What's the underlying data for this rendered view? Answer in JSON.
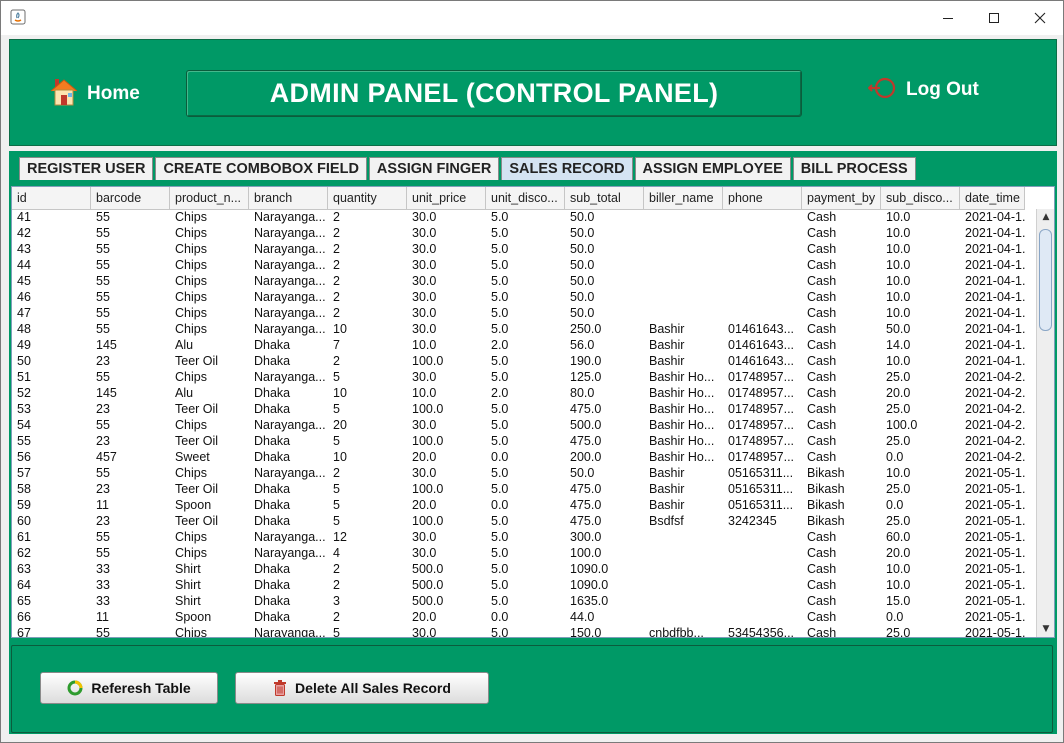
{
  "window": {
    "minimize": "—",
    "maximize": "☐",
    "close": "✕"
  },
  "header": {
    "home_label": "Home",
    "title": "ADMIN PANEL (CONTROL PANEL)",
    "logout_label": "Log Out"
  },
  "tabs": [
    {
      "label": "REGISTER USER",
      "active": false
    },
    {
      "label": "CREATE COMBOBOX FIELD",
      "active": false
    },
    {
      "label": "ASSIGN FINGER",
      "active": false
    },
    {
      "label": "SALES RECORD",
      "active": true
    },
    {
      "label": "ASSIGN EMPLOYEE",
      "active": false
    },
    {
      "label": "BILL PROCESS",
      "active": false
    }
  ],
  "table": {
    "columns": [
      "id",
      "barcode",
      "product_n...",
      "branch",
      "quantity",
      "unit_price",
      "unit_disco...",
      "sub_total",
      "biller_name",
      "phone",
      "payment_by",
      "sub_disco...",
      "date_time"
    ],
    "rows": [
      [
        "41",
        "55",
        "Chips",
        "Narayanga...",
        "2",
        "30.0",
        "5.0",
        "50.0",
        "",
        "",
        "Cash",
        "10.0",
        "2021-04-1..."
      ],
      [
        "42",
        "55",
        "Chips",
        "Narayanga...",
        "2",
        "30.0",
        "5.0",
        "50.0",
        "",
        "",
        "Cash",
        "10.0",
        "2021-04-1..."
      ],
      [
        "43",
        "55",
        "Chips",
        "Narayanga...",
        "2",
        "30.0",
        "5.0",
        "50.0",
        "",
        "",
        "Cash",
        "10.0",
        "2021-04-1..."
      ],
      [
        "44",
        "55",
        "Chips",
        "Narayanga...",
        "2",
        "30.0",
        "5.0",
        "50.0",
        "",
        "",
        "Cash",
        "10.0",
        "2021-04-1..."
      ],
      [
        "45",
        "55",
        "Chips",
        "Narayanga...",
        "2",
        "30.0",
        "5.0",
        "50.0",
        "",
        "",
        "Cash",
        "10.0",
        "2021-04-1..."
      ],
      [
        "46",
        "55",
        "Chips",
        "Narayanga...",
        "2",
        "30.0",
        "5.0",
        "50.0",
        "",
        "",
        "Cash",
        "10.0",
        "2021-04-1..."
      ],
      [
        "47",
        "55",
        "Chips",
        "Narayanga...",
        "2",
        "30.0",
        "5.0",
        "50.0",
        "",
        "",
        "Cash",
        "10.0",
        "2021-04-1..."
      ],
      [
        "48",
        "55",
        "Chips",
        "Narayanga...",
        "10",
        "30.0",
        "5.0",
        "250.0",
        "Bashir",
        "01461643...",
        "Cash",
        "50.0",
        "2021-04-1..."
      ],
      [
        "49",
        "145",
        "Alu",
        "Dhaka",
        "7",
        "10.0",
        "2.0",
        "56.0",
        "Bashir",
        "01461643...",
        "Cash",
        "14.0",
        "2021-04-1..."
      ],
      [
        "50",
        "23",
        "Teer Oil",
        "Dhaka",
        "2",
        "100.0",
        "5.0",
        "190.0",
        "Bashir",
        "01461643...",
        "Cash",
        "10.0",
        "2021-04-1..."
      ],
      [
        "51",
        "55",
        "Chips",
        "Narayanga...",
        "5",
        "30.0",
        "5.0",
        "125.0",
        "Bashir Ho...",
        "01748957...",
        "Cash",
        "25.0",
        "2021-04-2..."
      ],
      [
        "52",
        "145",
        "Alu",
        "Dhaka",
        "10",
        "10.0",
        "2.0",
        "80.0",
        "Bashir Ho...",
        "01748957...",
        "Cash",
        "20.0",
        "2021-04-2..."
      ],
      [
        "53",
        "23",
        "Teer Oil",
        "Dhaka",
        "5",
        "100.0",
        "5.0",
        "475.0",
        "Bashir Ho...",
        "01748957...",
        "Cash",
        "25.0",
        "2021-04-2..."
      ],
      [
        "54",
        "55",
        "Chips",
        "Narayanga...",
        "20",
        "30.0",
        "5.0",
        "500.0",
        "Bashir Ho...",
        "01748957...",
        "Cash",
        "100.0",
        "2021-04-2..."
      ],
      [
        "55",
        "23",
        "Teer Oil",
        "Dhaka",
        "5",
        "100.0",
        "5.0",
        "475.0",
        "Bashir Ho...",
        "01748957...",
        "Cash",
        "25.0",
        "2021-04-2..."
      ],
      [
        "56",
        "457",
        "Sweet",
        "Dhaka",
        "10",
        "20.0",
        "0.0",
        "200.0",
        "Bashir Ho...",
        "01748957...",
        "Cash",
        "0.0",
        "2021-04-2..."
      ],
      [
        "57",
        "55",
        "Chips",
        "Narayanga...",
        "2",
        "30.0",
        "5.0",
        "50.0",
        "Bashir",
        "05165311...",
        "Bikash",
        "10.0",
        "2021-05-1..."
      ],
      [
        "58",
        "23",
        "Teer Oil",
        "Dhaka",
        "5",
        "100.0",
        "5.0",
        "475.0",
        "Bashir",
        "05165311...",
        "Bikash",
        "25.0",
        "2021-05-1..."
      ],
      [
        "59",
        "11",
        "Spoon",
        "Dhaka",
        "5",
        "20.0",
        "0.0",
        "475.0",
        "Bashir",
        "05165311...",
        "Bikash",
        "0.0",
        "2021-05-1..."
      ],
      [
        "60",
        "23",
        "Teer Oil",
        "Dhaka",
        "5",
        "100.0",
        "5.0",
        "475.0",
        "Bsdfsf",
        "3242345",
        "Bikash",
        "25.0",
        "2021-05-1..."
      ],
      [
        "61",
        "55",
        "Chips",
        "Narayanga...",
        "12",
        "30.0",
        "5.0",
        "300.0",
        "",
        "",
        "Cash",
        "60.0",
        "2021-05-1..."
      ],
      [
        "62",
        "55",
        "Chips",
        "Narayanga...",
        "4",
        "30.0",
        "5.0",
        "100.0",
        "",
        "",
        "Cash",
        "20.0",
        "2021-05-1..."
      ],
      [
        "63",
        "33",
        "Shirt",
        "Dhaka",
        "2",
        "500.0",
        "5.0",
        "1090.0",
        "",
        "",
        "Cash",
        "10.0",
        "2021-05-1..."
      ],
      [
        "64",
        "33",
        "Shirt",
        "Dhaka",
        "2",
        "500.0",
        "5.0",
        "1090.0",
        "",
        "",
        "Cash",
        "10.0",
        "2021-05-1..."
      ],
      [
        "65",
        "33",
        "Shirt",
        "Dhaka",
        "3",
        "500.0",
        "5.0",
        "1635.0",
        "",
        "",
        "Cash",
        "15.0",
        "2021-05-1..."
      ],
      [
        "66",
        "11",
        "Spoon",
        "Dhaka",
        "2",
        "20.0",
        "0.0",
        "44.0",
        "",
        "",
        "Cash",
        "0.0",
        "2021-05-1..."
      ],
      [
        "67",
        "55",
        "Chips",
        "Narayanga...",
        "5",
        "30.0",
        "5.0",
        "150.0",
        "cnbdfbb...",
        "53454356...",
        "Cash",
        "25.0",
        "2021-05-1..."
      ]
    ]
  },
  "actions": {
    "refresh_label": "Referesh Table",
    "delete_label": "Delete All Sales Record"
  },
  "icons": {
    "home": "house-icon",
    "logout": "logout-icon",
    "refresh": "refresh-icon",
    "delete": "trash-icon",
    "app": "java-app-icon"
  },
  "colors": {
    "panel_green": "#009966",
    "header_text": "#ffffff",
    "active_tab": "#d4e3f2"
  }
}
